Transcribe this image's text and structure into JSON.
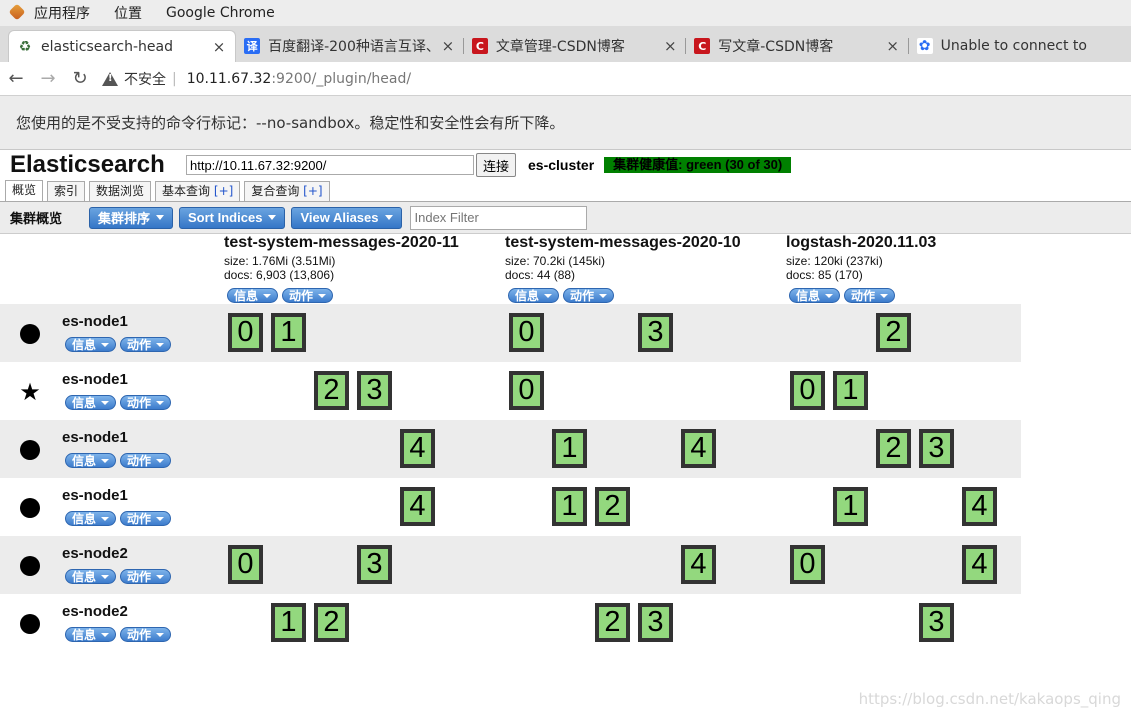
{
  "os_topbar": {
    "apps_menu": "应用程序",
    "places_menu": "位置",
    "active_app": "Google Chrome"
  },
  "browser": {
    "tabs": [
      {
        "title": "elasticsearch-head",
        "icon": "elasticsearch-icon",
        "close": "×"
      },
      {
        "title": "百度翻译-200种语言互译、",
        "icon": "baidu-translate-icon",
        "close": "×"
      },
      {
        "title": "文章管理-CSDN博客",
        "icon": "csdn-icon",
        "close": "×"
      },
      {
        "title": "写文章-CSDN博客",
        "icon": "csdn-icon",
        "close": "×"
      },
      {
        "title": "Unable to connect to",
        "icon": "baidu-paw-icon",
        "close": ""
      }
    ],
    "insecure_label": "不安全",
    "url_host": "10.11.67.32",
    "url_rest": ":9200/_plugin/head/",
    "infobar": "您使用的是不受支持的命令行标记：--no-sandbox。稳定性和安全性会有所下降。"
  },
  "es_head": {
    "brand": "Elasticsearch",
    "connect_url": "http://10.11.67.32:9200/",
    "connect_button": "连接",
    "cluster_name": "es-cluster",
    "health": "集群健康值: green (30 of 30)",
    "tabs": [
      {
        "label": "概览",
        "plus": ""
      },
      {
        "label": "索引",
        "plus": ""
      },
      {
        "label": "数据浏览",
        "plus": ""
      },
      {
        "label": "基本查询",
        "plus": "[+]"
      },
      {
        "label": "复合查询",
        "plus": "[+]"
      }
    ],
    "toolbar": {
      "title": "集群概览",
      "sort_cluster": "集群排序",
      "sort_indices": "Sort Indices",
      "view_aliases": "View Aliases",
      "filter_placeholder": "Index Filter"
    },
    "pill_info": "信息",
    "pill_action": "动作",
    "indices": [
      {
        "name": "test-system-messages-2020-11",
        "size": "size: 1.76Mi (3.51Mi)",
        "docs": "docs: 6,903 (13,806)"
      },
      {
        "name": "test-system-messages-2020-10",
        "size": "size: 70.2ki (145ki)",
        "docs": "docs: 44 (88)"
      },
      {
        "name": "logstash-2020.11.03",
        "size": "size: 120ki (237ki)",
        "docs": "docs: 85 (170)"
      }
    ],
    "nodes": [
      {
        "name": "es-node1",
        "icon": "dot",
        "shards": [
          [
            0,
            1
          ],
          [
            0,
            3
          ],
          [
            2
          ]
        ]
      },
      {
        "name": "es-node1",
        "icon": "star",
        "shards": [
          [
            2,
            3
          ],
          [
            0
          ],
          [
            0,
            1
          ]
        ]
      },
      {
        "name": "es-node1",
        "icon": "dot",
        "shards": [
          [
            4
          ],
          [
            1,
            4
          ],
          [
            2,
            3
          ]
        ]
      },
      {
        "name": "es-node1",
        "icon": "dot",
        "shards": [
          [
            4
          ],
          [
            1,
            2
          ],
          [
            1,
            4
          ]
        ]
      },
      {
        "name": "es-node2",
        "icon": "dot",
        "shards": [
          [
            0,
            3
          ],
          [
            4
          ],
          [
            0,
            4
          ]
        ]
      },
      {
        "name": "es-node2",
        "icon": "dot",
        "shards": [
          [
            1,
            2
          ],
          [
            2,
            3
          ],
          [
            3
          ]
        ]
      }
    ]
  },
  "watermark": "https://blog.csdn.net/kakaops_qing"
}
